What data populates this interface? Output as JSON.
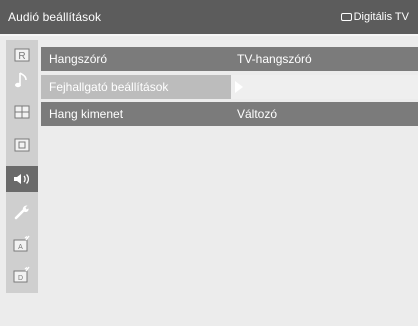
{
  "header": {
    "title": "Audió beállítások",
    "source_label": "Digitális TV",
    "source_icon": "tv-screen-icon"
  },
  "sidebar": {
    "items": [
      {
        "icon": "r-picture-icon",
        "active": false
      },
      {
        "icon": "music-note-icon",
        "active": false
      },
      {
        "icon": "grid-icon",
        "active": false
      },
      {
        "icon": "screen-icon",
        "active": false
      },
      {
        "icon": "speaker-icon",
        "active": true
      },
      {
        "icon": "wrench-icon",
        "active": false
      },
      {
        "icon": "antenna-a-icon",
        "active": false
      },
      {
        "icon": "antenna-d-icon",
        "active": false
      }
    ]
  },
  "menu": {
    "rows": [
      {
        "label": "Hangszóró",
        "value": "TV-hangszóró",
        "selected": false
      },
      {
        "label": "Fejhallgató beállítások",
        "value": "",
        "selected": true
      },
      {
        "label": "Hang kimenet",
        "value": "Változó",
        "selected": false
      }
    ]
  },
  "colors": {
    "titlebar": "#5c5c5c",
    "sidebar": "#cfcfcf",
    "sidebar_active": "#6a6a6a",
    "row": "#7b7b7b",
    "row_selected": "#bcbcbc",
    "background": "#ececec"
  }
}
